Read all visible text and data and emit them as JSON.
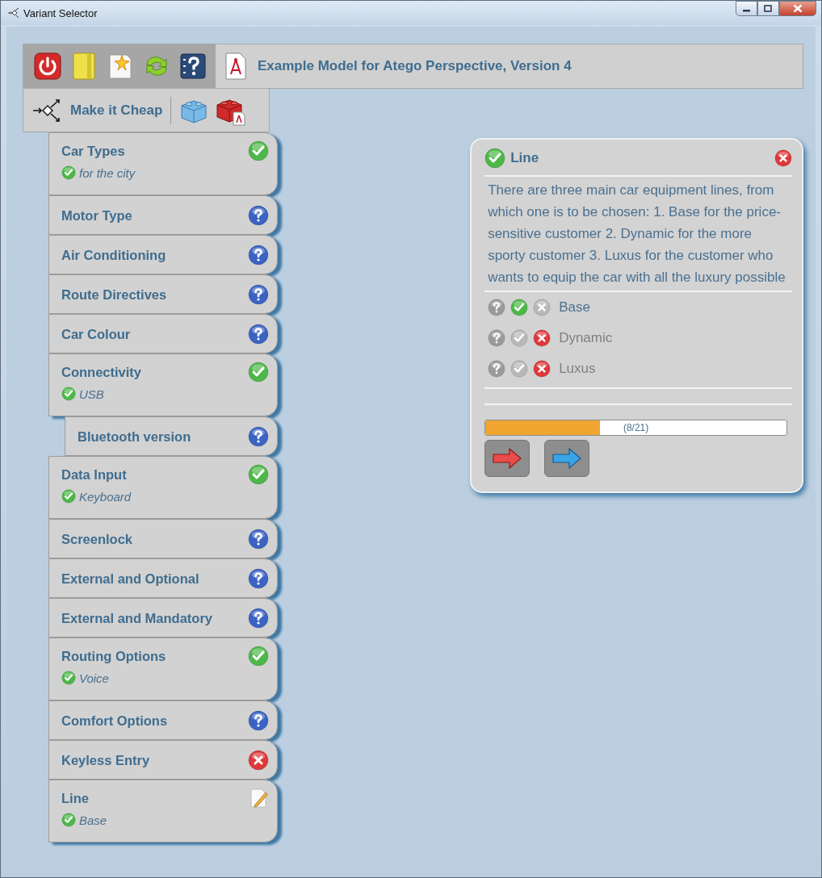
{
  "window": {
    "title": "Variant Selector"
  },
  "toolbar": {
    "model_title": "Example Model for Atego Perspective, Version 4",
    "variant": "Make it Cheap"
  },
  "features": [
    {
      "label": "Car Types",
      "kind": "done",
      "selection": "for the city"
    },
    {
      "label": "Motor Type",
      "kind": "open"
    },
    {
      "label": "Air Conditioning",
      "kind": "open"
    },
    {
      "label": "Route Directives",
      "kind": "open"
    },
    {
      "label": "Car Colour",
      "kind": "open"
    },
    {
      "label": "Connectivity",
      "kind": "done",
      "selection": "USB",
      "children": [
        {
          "label": "Bluetooth version",
          "kind": "open"
        }
      ]
    },
    {
      "label": "Data Input",
      "kind": "done",
      "selection": "Keyboard"
    },
    {
      "label": "Screenlock",
      "kind": "open"
    },
    {
      "label": "External and Optional",
      "kind": "open"
    },
    {
      "label": "External and Mandatory",
      "kind": "open"
    },
    {
      "label": "Routing Options",
      "kind": "done",
      "selection": "Voice"
    },
    {
      "label": "Comfort Options",
      "kind": "open"
    },
    {
      "label": "Keyless Entry",
      "kind": "rejected"
    },
    {
      "label": "Line",
      "kind": "editing",
      "selection": "Base"
    }
  ],
  "panel": {
    "title": "Line",
    "kind": "done",
    "description": "There are three main car equipment lines, from which one is to be chosen: 1. Base for the price-sensitive customer 2. Dynamic for the more sporty customer 3. Luxus for the customer who wants to equip the car with all the luxury possible",
    "options": [
      {
        "label": "Base",
        "selected": true,
        "excluded": false,
        "disabled": false
      },
      {
        "label": "Dynamic",
        "selected": false,
        "excluded": true,
        "disabled": true
      },
      {
        "label": "Luxus",
        "selected": false,
        "excluded": true,
        "disabled": true
      }
    ],
    "progress": {
      "level": 0.381,
      "reading": "(8/21)"
    }
  }
}
